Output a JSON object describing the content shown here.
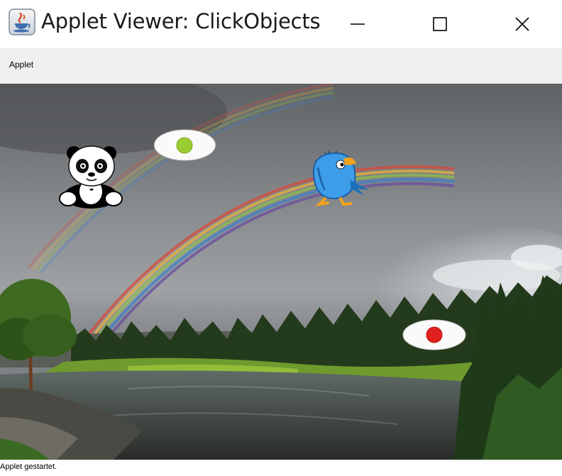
{
  "window": {
    "title": "Applet Viewer: ClickObjects",
    "icon": "java-cup-icon",
    "controls": [
      "minimize-icon",
      "maximize-icon",
      "close-icon"
    ]
  },
  "menu": {
    "items": [
      {
        "label": "Applet"
      }
    ]
  },
  "applet": {
    "background": "rainbow-landscape",
    "objects": [
      {
        "name": "panda",
        "icon": "panda-icon"
      },
      {
        "name": "bird",
        "icon": "blue-bird-icon"
      },
      {
        "name": "green-dot-ellipse",
        "color": "#9acd32"
      },
      {
        "name": "red-dot-ellipse",
        "color": "#e0201c"
      }
    ]
  },
  "status": {
    "text": "Applet gestartet."
  }
}
